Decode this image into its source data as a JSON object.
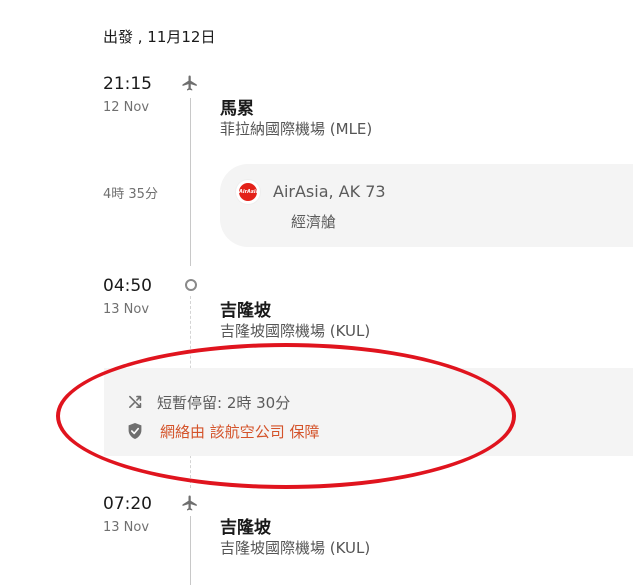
{
  "header": {
    "title": "出發 , 11月12日"
  },
  "segment1": {
    "dep_time": "21:15",
    "dep_date": "12 Nov",
    "dep_city": "馬累",
    "dep_airport": "菲拉納國際機場 (MLE)",
    "duration": "4時 35分",
    "airline_logo_text": "AirAsia",
    "airline": "AirAsia, AK 73",
    "cabin": "經濟艙",
    "arr_time": "04:50",
    "arr_date": "13 Nov",
    "arr_city": "吉隆坡",
    "arr_airport": "吉隆坡國際機場 (KUL)"
  },
  "layover": {
    "text": "短暫停留: 2時 30分",
    "protection": "網絡由 該航空公司 保障"
  },
  "segment2": {
    "dep_time": "07:20",
    "dep_date": "13 Nov",
    "dep_city": "吉隆坡",
    "dep_airport": "吉隆坡國際機場 (KUL)"
  },
  "colors": {
    "protection_text": "#d4532a",
    "highlight_ring": "#e0141e",
    "airline_brand": "#e32119"
  },
  "icons": [
    "plane-icon",
    "stop-circle-icon",
    "shuffle-icon",
    "shield-check-icon"
  ]
}
